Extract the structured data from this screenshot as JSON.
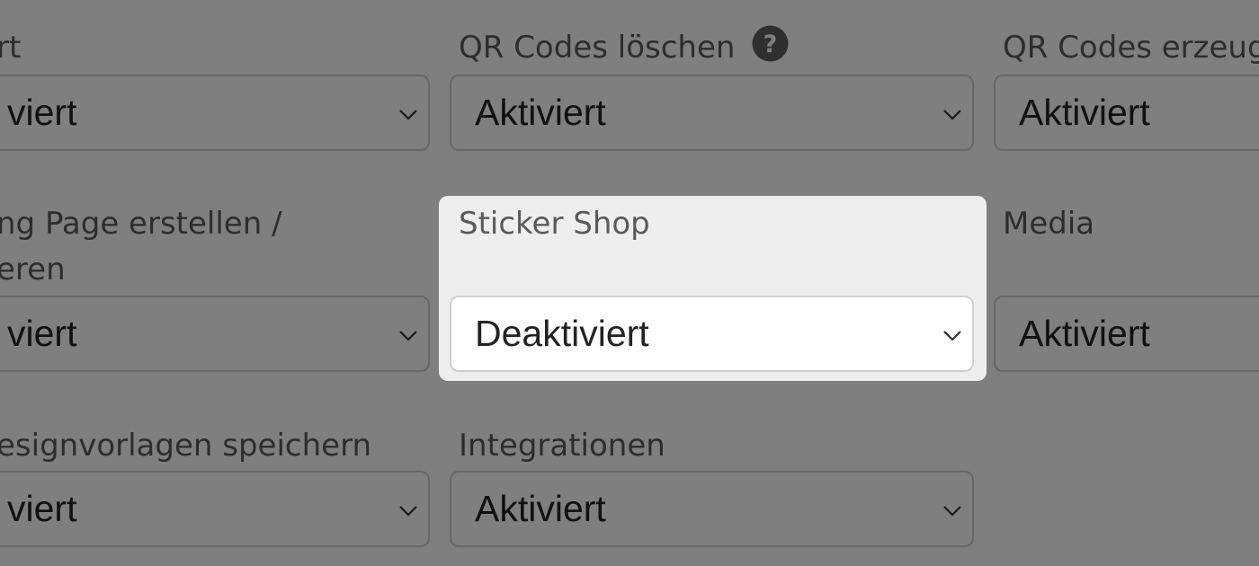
{
  "fields": [
    {
      "label": "rt",
      "value": "viert"
    },
    {
      "label": "QR Codes löschen",
      "value": "Aktiviert",
      "help_icon": "question-circle-icon"
    },
    {
      "label": "QR Codes erzeug",
      "value": "Aktiviert"
    },
    {
      "label_line1": "ng Page erstellen /",
      "label_line2": "eren",
      "value": "viert"
    },
    {
      "label": "Sticker Shop",
      "value": "Deaktiviert"
    },
    {
      "label": "Media",
      "value": "Aktiviert"
    },
    {
      "label": "esignvorlagen speichern",
      "value": "viert"
    },
    {
      "label": "Integrationen",
      "value": "Aktiviert"
    }
  ],
  "highlighted_field": "Sticker Shop",
  "colors": {
    "label": "#5a5a5a",
    "select_text": "#222222",
    "select_border": "#cfcfcf",
    "dim_overlay": "rgba(0,0,0,0.5)",
    "spotlight_bg": "#eeeeee"
  }
}
